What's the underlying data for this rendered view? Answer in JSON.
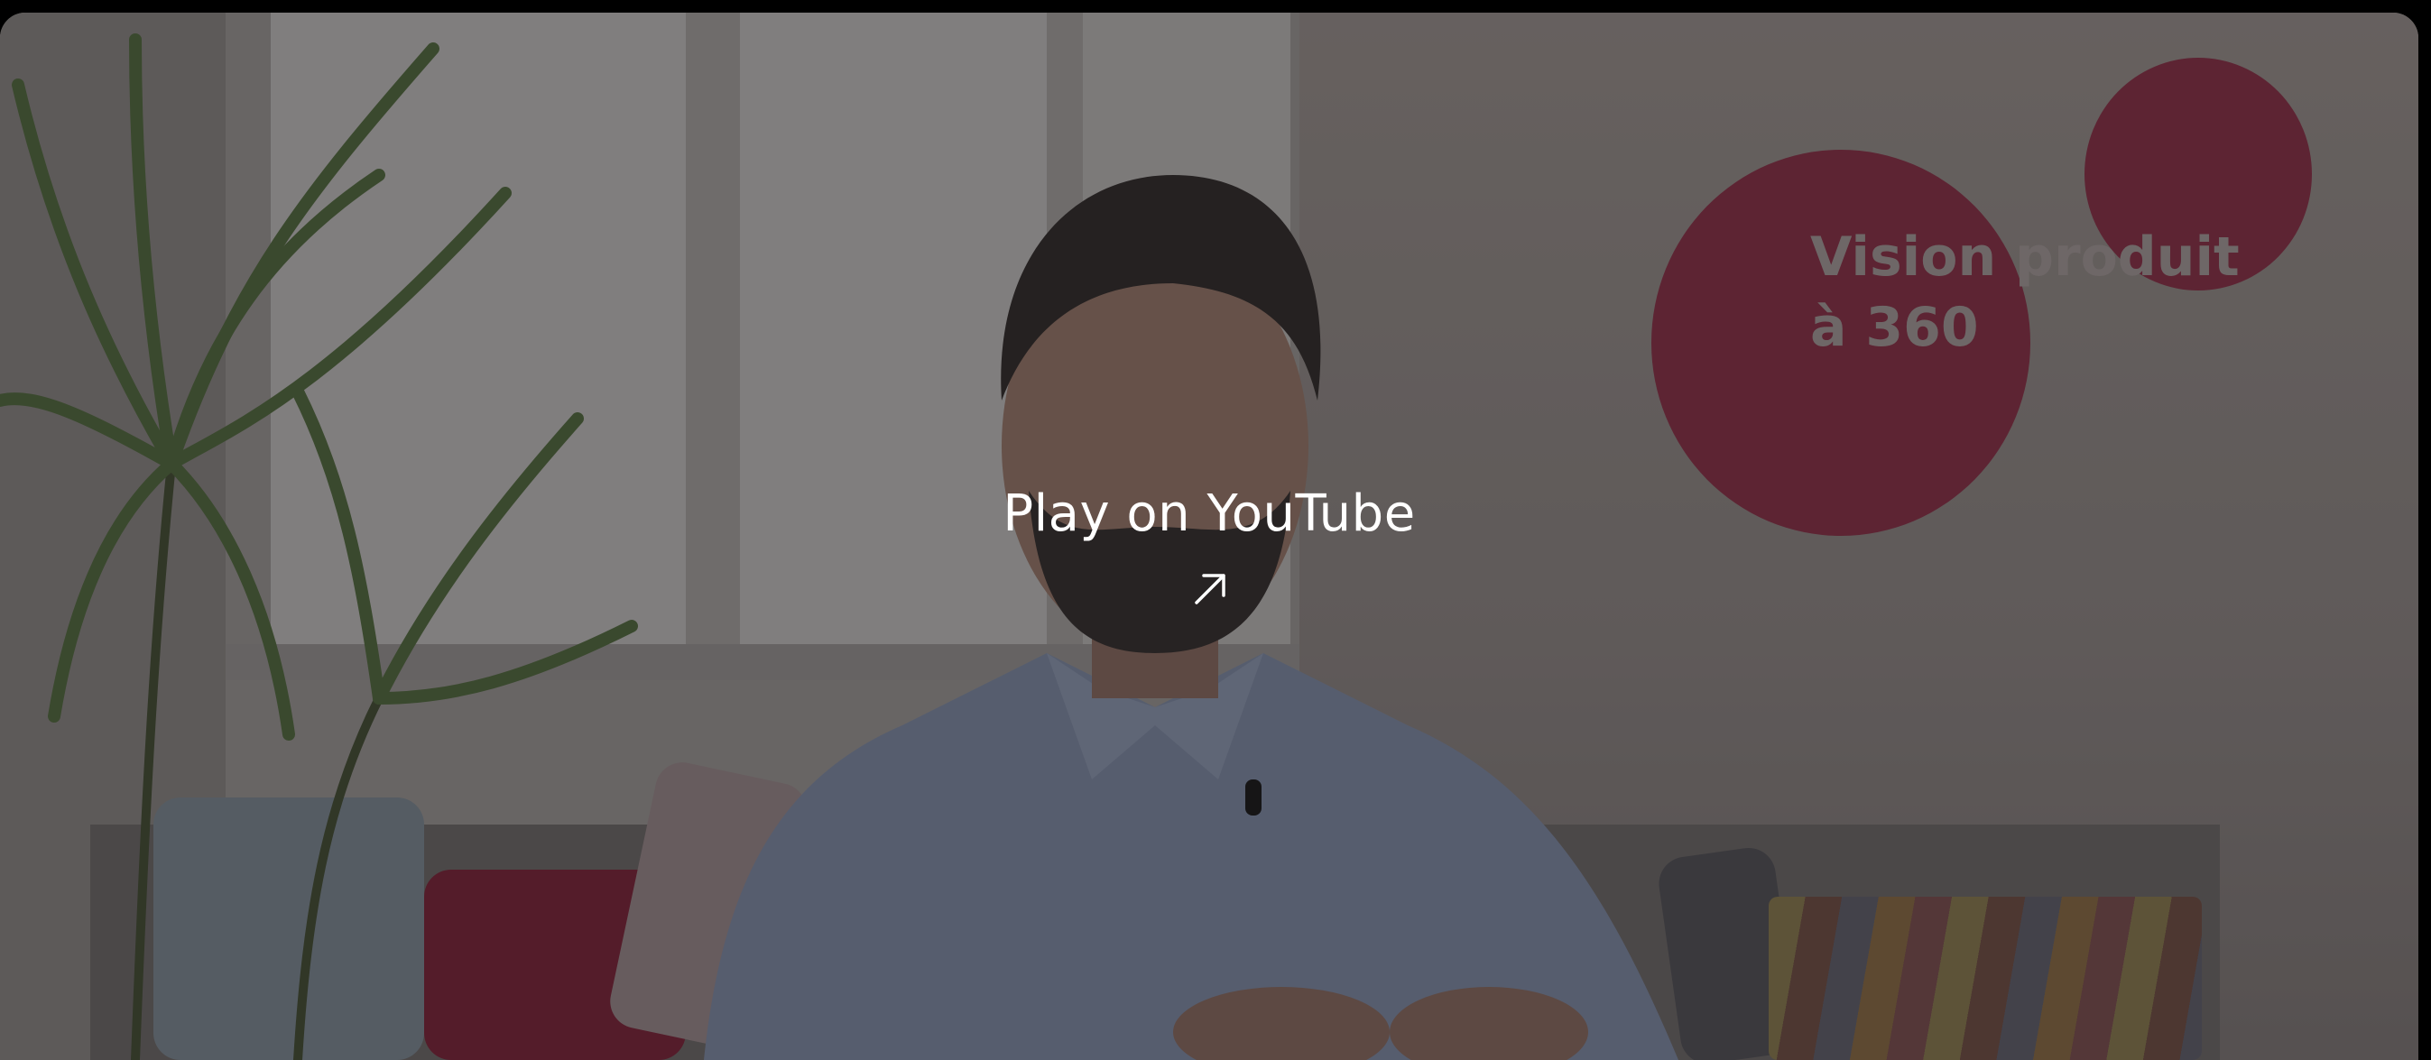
{
  "video": {
    "overlay_text_line1": "Vision produit",
    "overlay_text_line2": "à 360"
  },
  "player": {
    "play_label": "Play on YouTube",
    "play_icon": "external-arrow-icon"
  },
  "colors": {
    "circle": "#8a2a42",
    "text": "#ffffff",
    "background": "#000000"
  }
}
